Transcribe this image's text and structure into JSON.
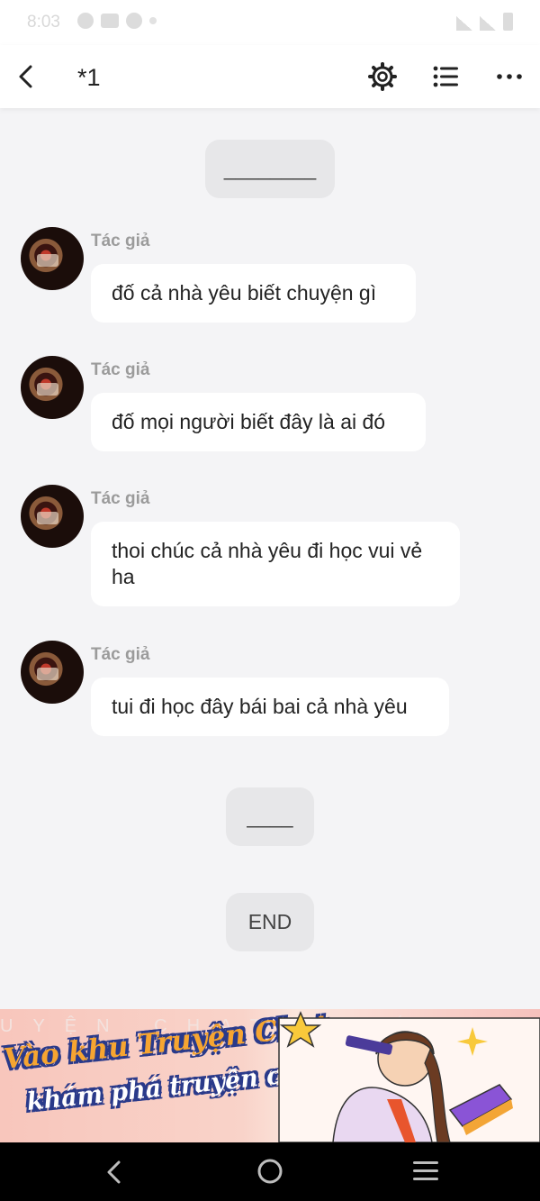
{
  "status_bar": {
    "time": "8:03"
  },
  "header": {
    "title": "*1",
    "icons": [
      "back-icon",
      "settings-icon",
      "list-icon",
      "more-icon"
    ]
  },
  "chat": {
    "separator_top": "________",
    "messages": [
      {
        "author": "Tác giả",
        "text": "đố cả nhà yêu biết chuyện gì"
      },
      {
        "author": "Tác giả",
        "text": "đố mọi người biết đây là ai đó"
      },
      {
        "author": "Tác giả",
        "text": "thoi chúc cả nhà yêu đi học vui vẻ ha"
      },
      {
        "author": "Tác giả",
        "text": "tui đi học đây bái bai cả nhà yêu"
      }
    ],
    "separator_mid": "____",
    "end_label": "END"
  },
  "banner": {
    "bg_text": "UYỆN CHAT. KHÁM PHÁ",
    "line1": "Vào khu Truyện Chat,",
    "line2": "khám phá truyện chất"
  },
  "nav_bar": {
    "icons": [
      "nav-back-icon",
      "nav-home-icon",
      "nav-recents-icon"
    ]
  },
  "colors": {
    "background": "#f4f4f6",
    "bubble": "#ffffff",
    "pill": "#e7e7e9",
    "author": "#9b9b9b"
  }
}
